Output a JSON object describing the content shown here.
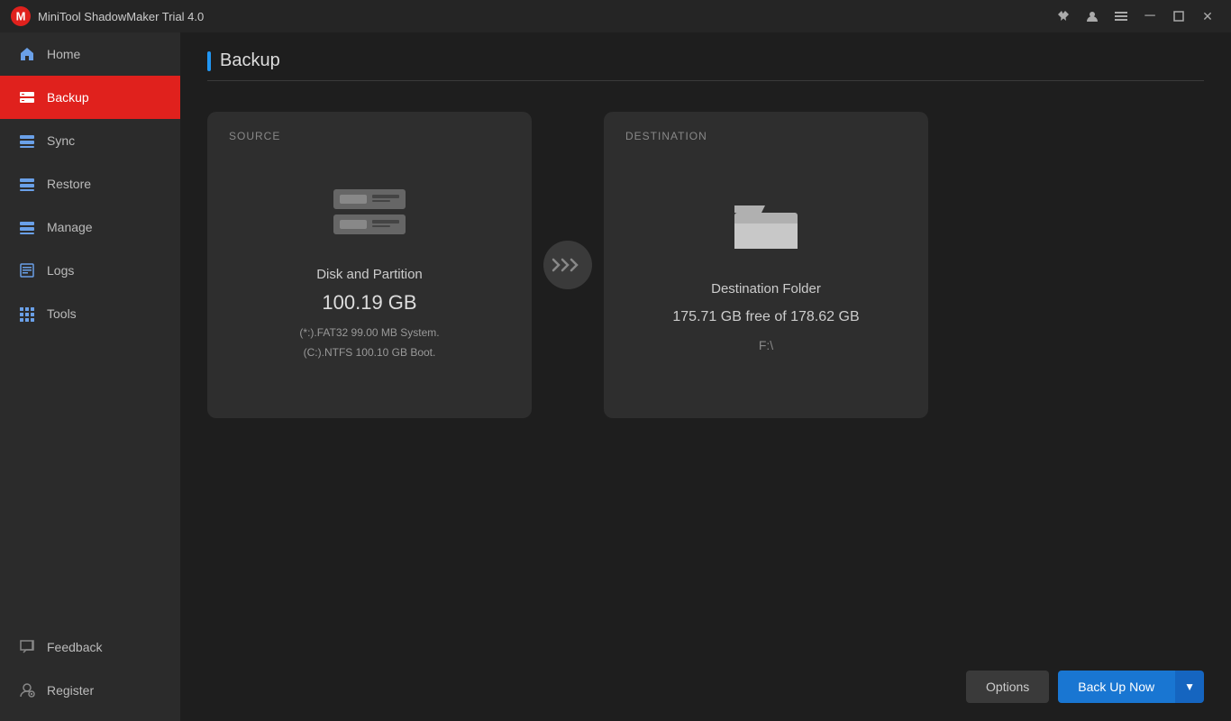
{
  "app": {
    "logo_text": "M",
    "title": "MiniTool ShadowMaker Trial 4.0"
  },
  "titlebar": {
    "pin_icon": "📌",
    "user_icon": "👤",
    "menu_icon": "≡",
    "minimize_icon": "─",
    "maximize_icon": "□",
    "close_icon": "✕"
  },
  "sidebar": {
    "items": [
      {
        "id": "home",
        "label": "Home",
        "active": false
      },
      {
        "id": "backup",
        "label": "Backup",
        "active": true
      },
      {
        "id": "sync",
        "label": "Sync",
        "active": false
      },
      {
        "id": "restore",
        "label": "Restore",
        "active": false
      },
      {
        "id": "manage",
        "label": "Manage",
        "active": false
      },
      {
        "id": "logs",
        "label": "Logs",
        "active": false
      },
      {
        "id": "tools",
        "label": "Tools",
        "active": false
      }
    ],
    "bottom_items": [
      {
        "id": "feedback",
        "label": "Feedback"
      },
      {
        "id": "register",
        "label": "Register"
      }
    ]
  },
  "page": {
    "title": "Backup"
  },
  "source_card": {
    "section_label": "SOURCE",
    "type_text": "Disk and Partition",
    "size_text": "100.19 GB",
    "detail_line1": "(*:).FAT32 99.00 MB System.",
    "detail_line2": "(C:).NTFS 100.10 GB Boot."
  },
  "destination_card": {
    "section_label": "DESTINATION",
    "type_text": "Destination Folder",
    "free_text": "175.71 GB free of 178.62 GB",
    "drive_text": "F:\\"
  },
  "buttons": {
    "options_label": "Options",
    "backup_now_label": "Back Up Now",
    "dropdown_arrow": "▼"
  },
  "colors": {
    "accent_blue": "#2196f3",
    "active_red": "#e0211d",
    "card_bg": "#2e2e2e",
    "sidebar_bg": "#2b2b2b",
    "titlebar_bg": "#252525",
    "content_bg": "#1e1e1e"
  }
}
